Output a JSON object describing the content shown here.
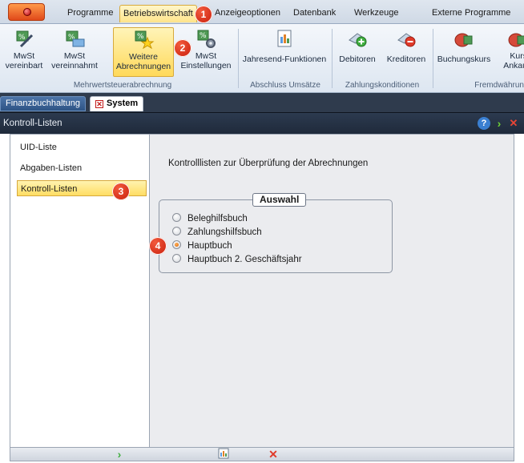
{
  "ribbon_tabs": [
    {
      "label": "Programme"
    },
    {
      "label": "Betriebswirtschaft"
    },
    {
      "label": "Anzeigeoptionen"
    },
    {
      "label": "Datenbank"
    },
    {
      "label": "Werkzeuge"
    },
    {
      "label": "Externe Programme"
    }
  ],
  "ribbon_buttons": [
    {
      "line1": "MwSt",
      "line2": "vereinbart"
    },
    {
      "line1": "MwSt",
      "line2": "vereinnahmt"
    },
    {
      "line1": "Weitere",
      "line2": "Abrechnungen"
    },
    {
      "line1": "MwSt",
      "line2": "Einstellungen"
    },
    {
      "line1": "Jahresend-Funktionen"
    },
    {
      "line1": "Debitoren"
    },
    {
      "line1": "Kreditoren"
    },
    {
      "line1": "Buchungskurs"
    },
    {
      "line1": "Kurs",
      "line2": "Ankau"
    }
  ],
  "ribbon_groups": [
    {
      "label": "Mehrwertsteuerabrechnung"
    },
    {
      "label": "Abschluss Umsätze"
    },
    {
      "label": "Zahlungskonditionen"
    },
    {
      "label": "Fremdwährun"
    }
  ],
  "document_tabs": [
    {
      "label": "Finanzbuchhaltung"
    },
    {
      "label": "System"
    }
  ],
  "panel": {
    "title": "Kontroll-Listen"
  },
  "sidebar": {
    "items": [
      {
        "label": "UID-Liste"
      },
      {
        "label": "Abgaben-Listen"
      },
      {
        "label": "Kontroll-Listen",
        "selected": true
      }
    ]
  },
  "content": {
    "description": "Kontrolllisten zur Überprüfung der Abrechnungen",
    "groupbox_title": "Auswahl",
    "options": [
      {
        "label": "Beleghilfsbuch",
        "checked": false
      },
      {
        "label": "Zahlungshilfsbuch",
        "checked": false
      },
      {
        "label": "Hauptbuch",
        "checked": true
      },
      {
        "label": "Hauptbuch 2. Geschäftsjahr",
        "checked": false
      }
    ]
  },
  "callouts": [
    "1",
    "2",
    "3",
    "4"
  ],
  "colors": {
    "accent_highlight": "#ffd95a",
    "panel_header": "#1f2a3b",
    "callout": "#d52a12"
  }
}
